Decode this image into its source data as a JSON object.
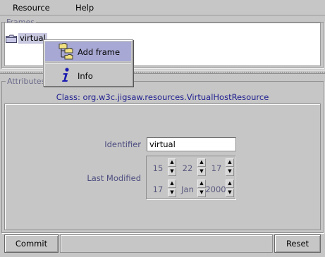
{
  "menubar": {
    "items": [
      "Resource",
      "Help"
    ]
  },
  "frames_panel": {
    "title": "Frames",
    "tree": {
      "node_label": "virtual",
      "node_icon": "folder-icon"
    }
  },
  "context_menu": {
    "items": [
      {
        "label": "Add frame",
        "icon": "add-frame-icon",
        "highlighted": true
      },
      {
        "label": "Info",
        "icon": "info-icon",
        "highlighted": false
      }
    ]
  },
  "attributes_panel": {
    "title": "Attributes",
    "class_line": "Class: org.w3c.jigsaw.resources.VirtualHostResource",
    "identifier": {
      "label": "Identifier",
      "value": "virtual"
    },
    "last_modified": {
      "label": "Last Modified",
      "hour": "15",
      "minute": "22",
      "second": "17",
      "day": "17",
      "month": "Jan",
      "year": "2000"
    }
  },
  "buttons": {
    "commit": "Commit",
    "reset": "Reset"
  },
  "colors": {
    "background": "#c6c6c6",
    "highlight": "#a8a8d4",
    "class_text": "#202090",
    "label_text": "#4c4c80"
  }
}
